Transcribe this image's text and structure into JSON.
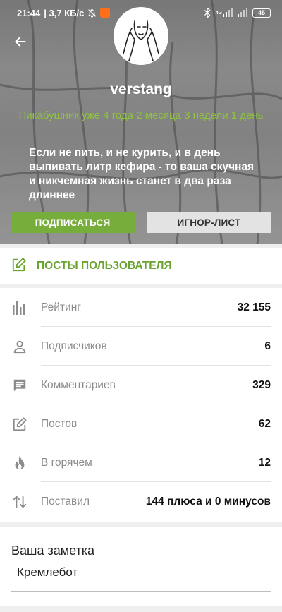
{
  "status_bar": {
    "time": "21:44",
    "net_speed": "| 3,7 КБ/с",
    "signal_label": "4G",
    "battery": "45"
  },
  "profile": {
    "username": "verstang",
    "member_since": "Пикабушник уже 4 года 2 месяца 3 недели 1 день",
    "bio": "Если не пить, и не курить, и в день выпивать литр кефира - то ваша скучная и никчемная жизнь станет в два раза длиннее",
    "subscribe_label": "ПОДПИСАТЬСЯ",
    "ignore_label": "ИГНОР-ЛИСТ"
  },
  "posts_link": {
    "label": "ПОСТЫ ПОЛЬЗОВАТЕЛЯ"
  },
  "stats": [
    {
      "icon": "bar-chart-icon",
      "label": "Рейтинг",
      "value": "32 155"
    },
    {
      "icon": "person-icon",
      "label": "Подписчиков",
      "value": "6"
    },
    {
      "icon": "comment-icon",
      "label": "Комментариев",
      "value": "329"
    },
    {
      "icon": "edit-icon",
      "label": "Постов",
      "value": "62"
    },
    {
      "icon": "flame-icon",
      "label": "В горячем",
      "value": "12"
    },
    {
      "icon": "swap-vertical-icon",
      "label": "Поставил",
      "value": "144 плюса и 0 минусов"
    }
  ],
  "note": {
    "title": "Ваша заметка",
    "text": "Кремлебот"
  },
  "colors": {
    "accent_green": "#77ad3b",
    "link_green": "#6aa32f",
    "since_green": "#8fc33f"
  }
}
